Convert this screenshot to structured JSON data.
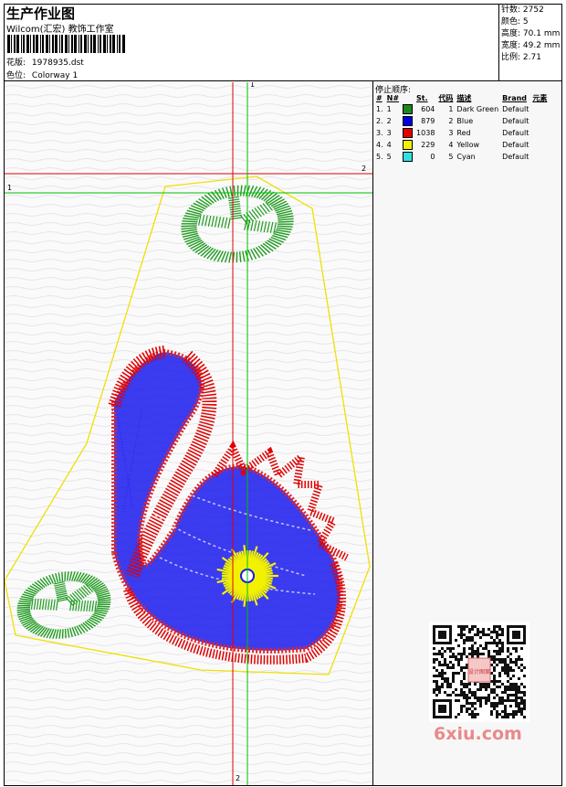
{
  "header": {
    "title": "生产作业图",
    "company": "Wilcom(汇宏) 教饰工作室",
    "design_file_label": "花版:",
    "design_file": "1978935.dst",
    "colorway_label": "色位:",
    "colorway": "Colorway 1"
  },
  "stats": {
    "stitches_label": "针数:",
    "stitches": "2752",
    "colors_label": "颜色:",
    "colors": "5",
    "height_label": "高度:",
    "height": "70.1 mm",
    "width_label": "宽度:",
    "width": "49.2 mm",
    "ratio_label": "比例:",
    "ratio": "2.71"
  },
  "stop_sequence": {
    "title": "停止顺序:",
    "headers": [
      "#",
      "N#",
      "St.",
      "代码",
      "描述",
      "Brand",
      "元素"
    ],
    "rows": [
      {
        "idx": "1.",
        "n": "1",
        "color": "#1a8a1a",
        "st": "604",
        "code": "1",
        "desc": "Dark Green",
        "brand": "Default"
      },
      {
        "idx": "2.",
        "n": "2",
        "color": "#0000e0",
        "st": "879",
        "code": "2",
        "desc": "Blue",
        "brand": "Default"
      },
      {
        "idx": "3.",
        "n": "3",
        "color": "#e00000",
        "st": "1038",
        "code": "3",
        "desc": "Red",
        "brand": "Default"
      },
      {
        "idx": "4.",
        "n": "4",
        "color": "#f0f000",
        "st": "229",
        "code": "4",
        "desc": "Yellow",
        "brand": "Default"
      },
      {
        "idx": "5.",
        "n": "5",
        "color": "#30e0e0",
        "st": "0",
        "code": "5",
        "desc": "Cyan",
        "brand": "Default"
      }
    ]
  },
  "guides": {
    "green_v_label": "1",
    "green_h_label": "1",
    "red_h_label": "2",
    "red_v_label": "2"
  },
  "watermark": "6xiu.com",
  "qr_stamp_text": "设计图案"
}
